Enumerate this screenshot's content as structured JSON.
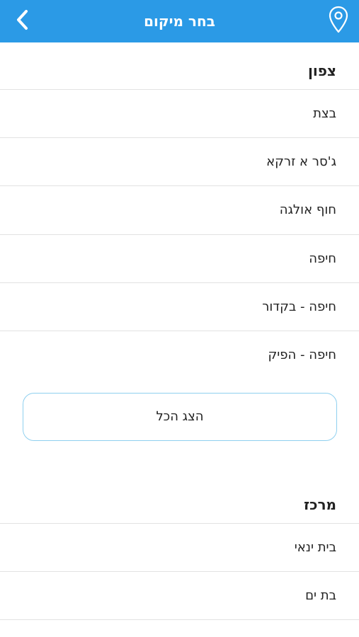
{
  "header": {
    "title": "בחר מיקום",
    "back_icon": "chevron-left-icon",
    "location_icon": "map-pin-icon",
    "background_color": "#2b9ae6"
  },
  "sections": [
    {
      "title": "צפון",
      "items": [
        "בצת",
        "ג'סר א זרקא",
        "חוף אולגה",
        "חיפה",
        "חיפה - בקדור",
        "חיפה - הפיק"
      ],
      "show_all_label": "הצג הכל"
    },
    {
      "title": "מרכז",
      "items": [
        "בית ינאי",
        "בת ים"
      ]
    }
  ]
}
